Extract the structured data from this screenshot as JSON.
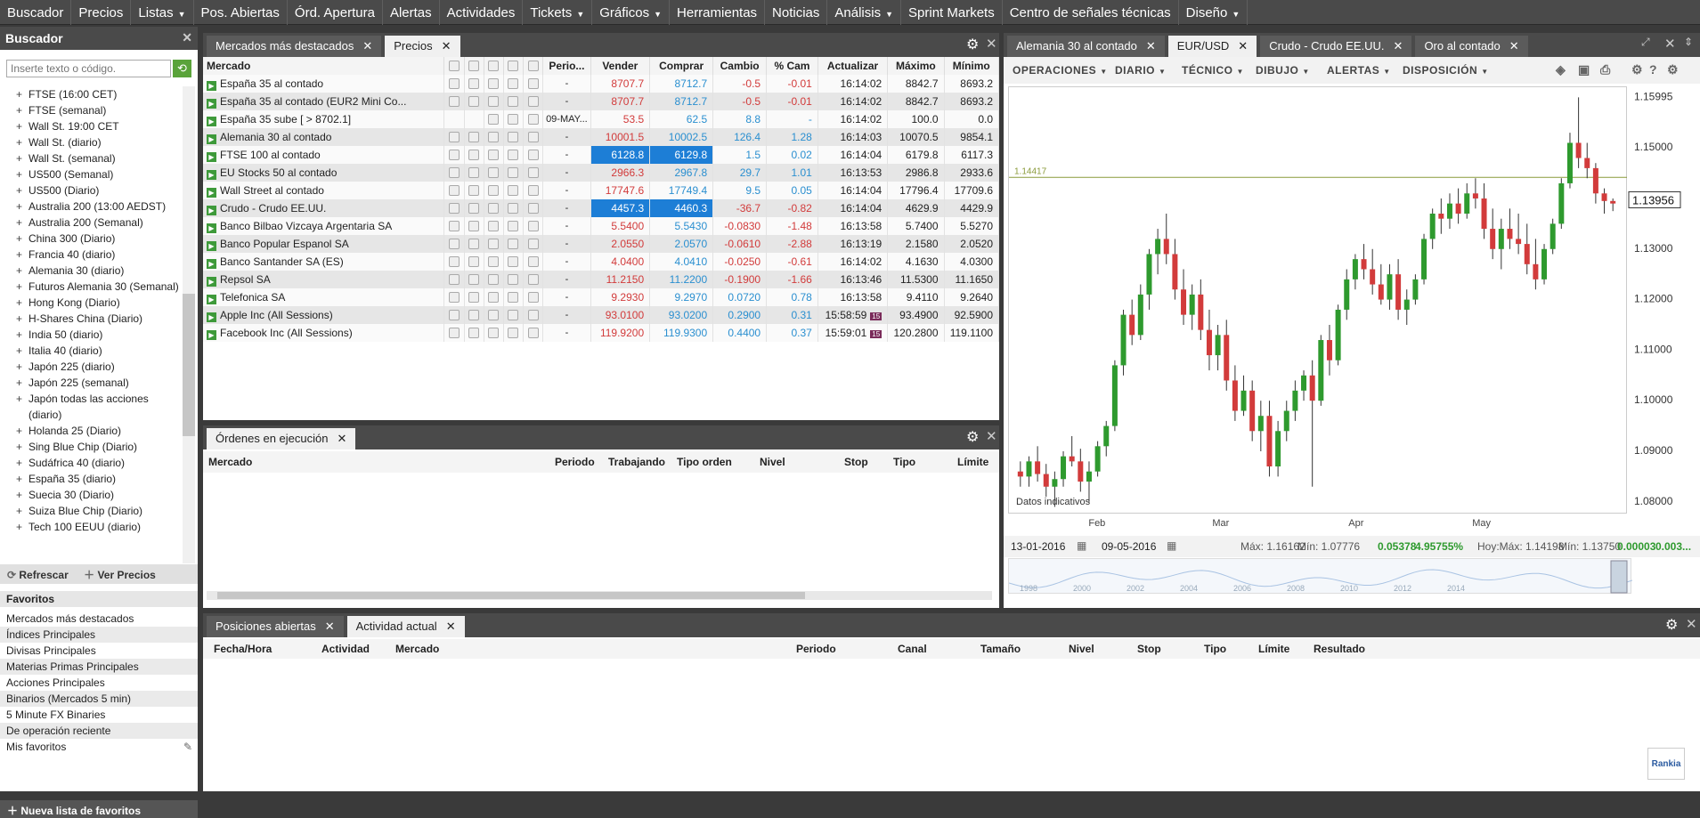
{
  "menu": [
    "Buscador",
    "Precios",
    "Listas",
    "Pos. Abiertas",
    "Órd. Apertura",
    "Alertas",
    "Actividades",
    "Tickets",
    "Gráficos",
    "Herramientas",
    "Noticias",
    "Análisis",
    "Sprint Markets",
    "Centro de señales técnicas",
    "Diseño"
  ],
  "menu_dropdown": [
    false,
    false,
    true,
    false,
    false,
    false,
    false,
    true,
    true,
    false,
    false,
    true,
    false,
    false,
    true
  ],
  "buscador": {
    "title": "Buscador",
    "search_placeholder": "Inserte texto o código.",
    "tree": [
      "FTSE (16:00 CET)",
      "FTSE (semanal)",
      "Wall St. 19:00 CET",
      "Wall St. (diario)",
      "Wall St. (semanal)",
      "US500 (Semanal)",
      "US500 (Diario)",
      "Australia 200 (13:00 AEDST)",
      "Australia 200 (Semanal)",
      "China 300 (Diario)",
      "Francia 40 (diario)",
      "Alemania 30 (diario)",
      "Futuros Alemania 30 (Semanal)",
      "Hong Kong (Diario)",
      "H-Shares China (Diario)",
      "India 50 (diario)",
      "Italia 40 (diario)",
      "Japón 225 (diario)",
      "Japón 225 (semanal)",
      "Japón todas las acciones (diario)",
      "Holanda 25 (Diario)",
      "Sing Blue Chip (Diario)",
      "Sudáfrica 40 (diario)",
      "España 35 (diario)",
      "Suecia 30 (Diario)",
      "Suiza Blue Chip (Diario)",
      "Tech 100 EEUU (diario)"
    ],
    "refresh": "Refrescar",
    "view_prices": "Ver Precios",
    "favorites_title": "Favoritos",
    "favorites": [
      "Mercados más destacados",
      "Índices Principales",
      "Divisas Principales",
      "Materias Primas Principales",
      "Acciones Principales",
      "Binarios (Mercados 5 min)",
      "5 Minute FX Binaries",
      "De operación reciente",
      "Mis favoritos"
    ],
    "new_list": "Nueva lista de favoritos"
  },
  "precios": {
    "tabs": [
      "Mercados más destacados",
      "Precios"
    ],
    "columns": [
      "Mercado",
      "Perio...",
      "Vender",
      "Comprar",
      "Cambio",
      "% Cam",
      "Actualizar",
      "Máximo",
      "Mínimo"
    ],
    "rows": [
      {
        "m": "España 35 al contado",
        "p": "-",
        "v": "8707.7",
        "c": "8712.7",
        "ch": "-0.5",
        "pc": "-0.01",
        "t": "16:14:02",
        "max": "8842.7",
        "min": "8693.2",
        "dir": "neg"
      },
      {
        "m": "España 35 al contado (EUR2 Mini Co...",
        "p": "-",
        "v": "8707.7",
        "c": "8712.7",
        "ch": "-0.5",
        "pc": "-0.01",
        "t": "16:14:02",
        "max": "8842.7",
        "min": "8693.2",
        "dir": "neg"
      },
      {
        "m": "España 35 sube [ > 8702.1]",
        "p": "09-MAY...",
        "v": "53.5",
        "c": "62.5",
        "ch": "8.8",
        "pc": "-",
        "t": "16:14:02",
        "max": "100.0",
        "min": "0.0",
        "dir": "pos"
      },
      {
        "m": "Alemania 30 al contado",
        "p": "-",
        "v": "10001.5",
        "c": "10002.5",
        "ch": "126.4",
        "pc": "1.28",
        "t": "16:14:03",
        "max": "10070.5",
        "min": "9854.1",
        "dir": "pos"
      },
      {
        "m": "FTSE 100 al contado",
        "p": "-",
        "v": "6128.8",
        "c": "6129.8",
        "ch": "1.5",
        "pc": "0.02",
        "t": "16:14:04",
        "max": "6179.8",
        "min": "6117.3",
        "dir": "pos",
        "hl": true
      },
      {
        "m": "EU Stocks 50 al contado",
        "p": "-",
        "v": "2966.3",
        "c": "2967.8",
        "ch": "29.7",
        "pc": "1.01",
        "t": "16:13:53",
        "max": "2986.8",
        "min": "2933.6",
        "dir": "pos"
      },
      {
        "m": "Wall Street al contado",
        "p": "-",
        "v": "17747.6",
        "c": "17749.4",
        "ch": "9.5",
        "pc": "0.05",
        "t": "16:14:04",
        "max": "17796.4",
        "min": "17709.6",
        "dir": "pos"
      },
      {
        "m": "Crudo - Crudo EE.UU.",
        "p": "-",
        "v": "4457.3",
        "c": "4460.3",
        "ch": "-36.7",
        "pc": "-0.82",
        "t": "16:14:04",
        "max": "4629.9",
        "min": "4429.9",
        "dir": "neg",
        "hl": true
      },
      {
        "m": "Banco Bilbao Vizcaya Argentaria SA",
        "p": "-",
        "v": "5.5400",
        "c": "5.5430",
        "ch": "-0.0830",
        "pc": "-1.48",
        "t": "16:13:58",
        "max": "5.7400",
        "min": "5.5270",
        "dir": "neg"
      },
      {
        "m": "Banco Popular Espanol SA",
        "p": "-",
        "v": "2.0550",
        "c": "2.0570",
        "ch": "-0.0610",
        "pc": "-2.88",
        "t": "16:13:19",
        "max": "2.1580",
        "min": "2.0520",
        "dir": "neg"
      },
      {
        "m": "Banco Santander SA (ES)",
        "p": "-",
        "v": "4.0400",
        "c": "4.0410",
        "ch": "-0.0250",
        "pc": "-0.61",
        "t": "16:14:02",
        "max": "4.1630",
        "min": "4.0300",
        "dir": "neg"
      },
      {
        "m": "Repsol SA",
        "p": "-",
        "v": "11.2150",
        "c": "11.2200",
        "ch": "-0.1900",
        "pc": "-1.66",
        "t": "16:13:46",
        "max": "11.5300",
        "min": "11.1650",
        "dir": "neg"
      },
      {
        "m": "Telefonica SA",
        "p": "-",
        "v": "9.2930",
        "c": "9.2970",
        "ch": "0.0720",
        "pc": "0.78",
        "t": "16:13:58",
        "max": "9.4110",
        "min": "9.2640",
        "dir": "pos"
      },
      {
        "m": "Apple Inc (All Sessions)",
        "p": "-",
        "v": "93.0100",
        "c": "93.0200",
        "ch": "0.2900",
        "pc": "0.31",
        "t": "15:58:59",
        "max": "93.4900",
        "min": "92.5900",
        "dir": "pos",
        "ev": "15"
      },
      {
        "m": "Facebook Inc (All Sessions)",
        "p": "-",
        "v": "119.9200",
        "c": "119.9300",
        "ch": "0.4400",
        "pc": "0.37",
        "t": "15:59:01",
        "max": "120.2800",
        "min": "119.1100",
        "dir": "pos",
        "ev": "15"
      }
    ]
  },
  "ordenes": {
    "tab": "Órdenes en ejecución",
    "columns": [
      "Mercado",
      "Periodo",
      "Trabajando",
      "Tipo orden",
      "Nivel",
      "Stop",
      "Tipo",
      "Límite"
    ]
  },
  "chart": {
    "tabs": [
      "Alemania 30 al contado",
      "EUR/USD",
      "Crudo - Crudo EE.UU.",
      "Oro al contado"
    ],
    "toolbar": [
      "OPERACIONES",
      "DIARIO",
      "TÉCNICO",
      "DIBUJO",
      "ALERTAS",
      "DISPOSICIÓN"
    ],
    "hline_label": "1.14417",
    "current_price": "1.13956",
    "note": "Datos indicativos",
    "footer": {
      "from": "13-01-2016",
      "to": "09-05-2016",
      "max": "Máx: 1.16162",
      "min": "Mín: 1.07776",
      "chg": "0.05378",
      "pct": "4.95755%",
      "today": "Hoy:Máx: 1.14198",
      "todaymin": "Mín: 1.13750",
      "tchg": "0.00003",
      "tpct": "0.003..."
    },
    "navigator_years": [
      "1998",
      "2000",
      "2002",
      "2004",
      "2006",
      "2008",
      "2010",
      "2012",
      "2014"
    ]
  },
  "chart_data": {
    "type": "candlestick",
    "x_ticks": [
      "Feb",
      "Mar",
      "Apr",
      "May"
    ],
    "y_ticks": [
      "1.15995",
      "1.15000",
      "1.14000",
      "1.13000",
      "1.12000",
      "1.11000",
      "1.10000",
      "1.09000",
      "1.08000"
    ],
    "ylim": [
      1.0775,
      1.162
    ],
    "hline": 1.14417,
    "candles": [
      [
        1.086,
        1.088,
        1.083,
        1.085
      ],
      [
        1.085,
        1.089,
        1.083,
        1.088
      ],
      [
        1.088,
        1.091,
        1.084,
        1.0855
      ],
      [
        1.0855,
        1.0875,
        1.081,
        1.083
      ],
      [
        1.083,
        1.086,
        1.079,
        1.0845
      ],
      [
        1.0845,
        1.09,
        1.083,
        1.089
      ],
      [
        1.089,
        1.093,
        1.087,
        1.088
      ],
      [
        1.088,
        1.0905,
        1.082,
        1.084
      ],
      [
        1.084,
        1.088,
        1.08,
        1.086
      ],
      [
        1.086,
        1.092,
        1.085,
        1.091
      ],
      [
        1.091,
        1.096,
        1.089,
        1.095
      ],
      [
        1.095,
        1.108,
        1.094,
        1.107
      ],
      [
        1.107,
        1.118,
        1.105,
        1.117
      ],
      [
        1.117,
        1.12,
        1.111,
        1.113
      ],
      [
        1.113,
        1.123,
        1.112,
        1.121
      ],
      [
        1.121,
        1.13,
        1.118,
        1.129
      ],
      [
        1.129,
        1.134,
        1.125,
        1.132
      ],
      [
        1.132,
        1.137,
        1.127,
        1.129
      ],
      [
        1.129,
        1.132,
        1.12,
        1.122
      ],
      [
        1.122,
        1.126,
        1.115,
        1.117
      ],
      [
        1.117,
        1.123,
        1.114,
        1.121
      ],
      [
        1.121,
        1.124,
        1.112,
        1.114
      ],
      [
        1.114,
        1.118,
        1.106,
        1.109
      ],
      [
        1.109,
        1.115,
        1.106,
        1.113
      ],
      [
        1.113,
        1.116,
        1.102,
        1.104
      ],
      [
        1.104,
        1.107,
        1.096,
        1.098
      ],
      [
        1.098,
        1.105,
        1.097,
        1.102
      ],
      [
        1.102,
        1.104,
        1.092,
        1.094
      ],
      [
        1.094,
        1.1,
        1.09,
        1.097
      ],
      [
        1.097,
        1.1,
        1.085,
        1.087
      ],
      [
        1.087,
        1.096,
        1.085,
        1.094
      ],
      [
        1.094,
        1.1,
        1.092,
        1.098
      ],
      [
        1.098,
        1.104,
        1.096,
        1.102
      ],
      [
        1.102,
        1.106,
        1.1,
        1.105
      ],
      [
        1.105,
        1.108,
        1.083,
        1.1
      ],
      [
        1.1,
        1.113,
        1.099,
        1.112
      ],
      [
        1.112,
        1.115,
        1.105,
        1.108
      ],
      [
        1.108,
        1.119,
        1.107,
        1.118
      ],
      [
        1.118,
        1.126,
        1.116,
        1.124
      ],
      [
        1.124,
        1.129,
        1.122,
        1.128
      ],
      [
        1.128,
        1.131,
        1.124,
        1.126
      ],
      [
        1.126,
        1.13,
        1.121,
        1.123
      ],
      [
        1.123,
        1.127,
        1.119,
        1.12
      ],
      [
        1.12,
        1.127,
        1.118,
        1.125
      ],
      [
        1.125,
        1.128,
        1.116,
        1.118
      ],
      [
        1.118,
        1.122,
        1.115,
        1.12
      ],
      [
        1.12,
        1.125,
        1.119,
        1.124
      ],
      [
        1.124,
        1.133,
        1.123,
        1.132
      ],
      [
        1.132,
        1.138,
        1.13,
        1.137
      ],
      [
        1.137,
        1.14,
        1.133,
        1.136
      ],
      [
        1.136,
        1.141,
        1.134,
        1.139
      ],
      [
        1.139,
        1.142,
        1.135,
        1.137
      ],
      [
        1.137,
        1.143,
        1.136,
        1.141
      ],
      [
        1.141,
        1.144,
        1.138,
        1.14
      ],
      [
        1.14,
        1.143,
        1.132,
        1.134
      ],
      [
        1.134,
        1.138,
        1.128,
        1.13
      ],
      [
        1.13,
        1.136,
        1.126,
        1.134
      ],
      [
        1.134,
        1.138,
        1.13,
        1.132
      ],
      [
        1.132,
        1.137,
        1.129,
        1.131
      ],
      [
        1.131,
        1.135,
        1.125,
        1.127
      ],
      [
        1.127,
        1.132,
        1.122,
        1.124
      ],
      [
        1.124,
        1.131,
        1.123,
        1.13
      ],
      [
        1.13,
        1.136,
        1.129,
        1.135
      ],
      [
        1.135,
        1.144,
        1.134,
        1.143
      ],
      [
        1.143,
        1.153,
        1.142,
        1.151
      ],
      [
        1.151,
        1.16,
        1.146,
        1.148
      ],
      [
        1.148,
        1.151,
        1.144,
        1.146
      ],
      [
        1.146,
        1.147,
        1.139,
        1.141
      ],
      [
        1.141,
        1.142,
        1.137,
        1.1395
      ],
      [
        1.1395,
        1.14,
        1.1375,
        1.139
      ]
    ]
  },
  "actividad": {
    "tabs": [
      "Posiciones abiertas",
      "Actividad actual"
    ],
    "columns": [
      "Fecha/Hora",
      "Actividad",
      "Mercado",
      "Periodo",
      "Canal",
      "Tamaño",
      "Nivel",
      "Stop",
      "Tipo",
      "Límite",
      "Resultado"
    ]
  },
  "logo": "Rankia",
  "colors": {
    "up": "#2e9a2e",
    "down": "#d23b3b",
    "highlight": "#1d7ed6",
    "hline": "#8a9a3a"
  }
}
